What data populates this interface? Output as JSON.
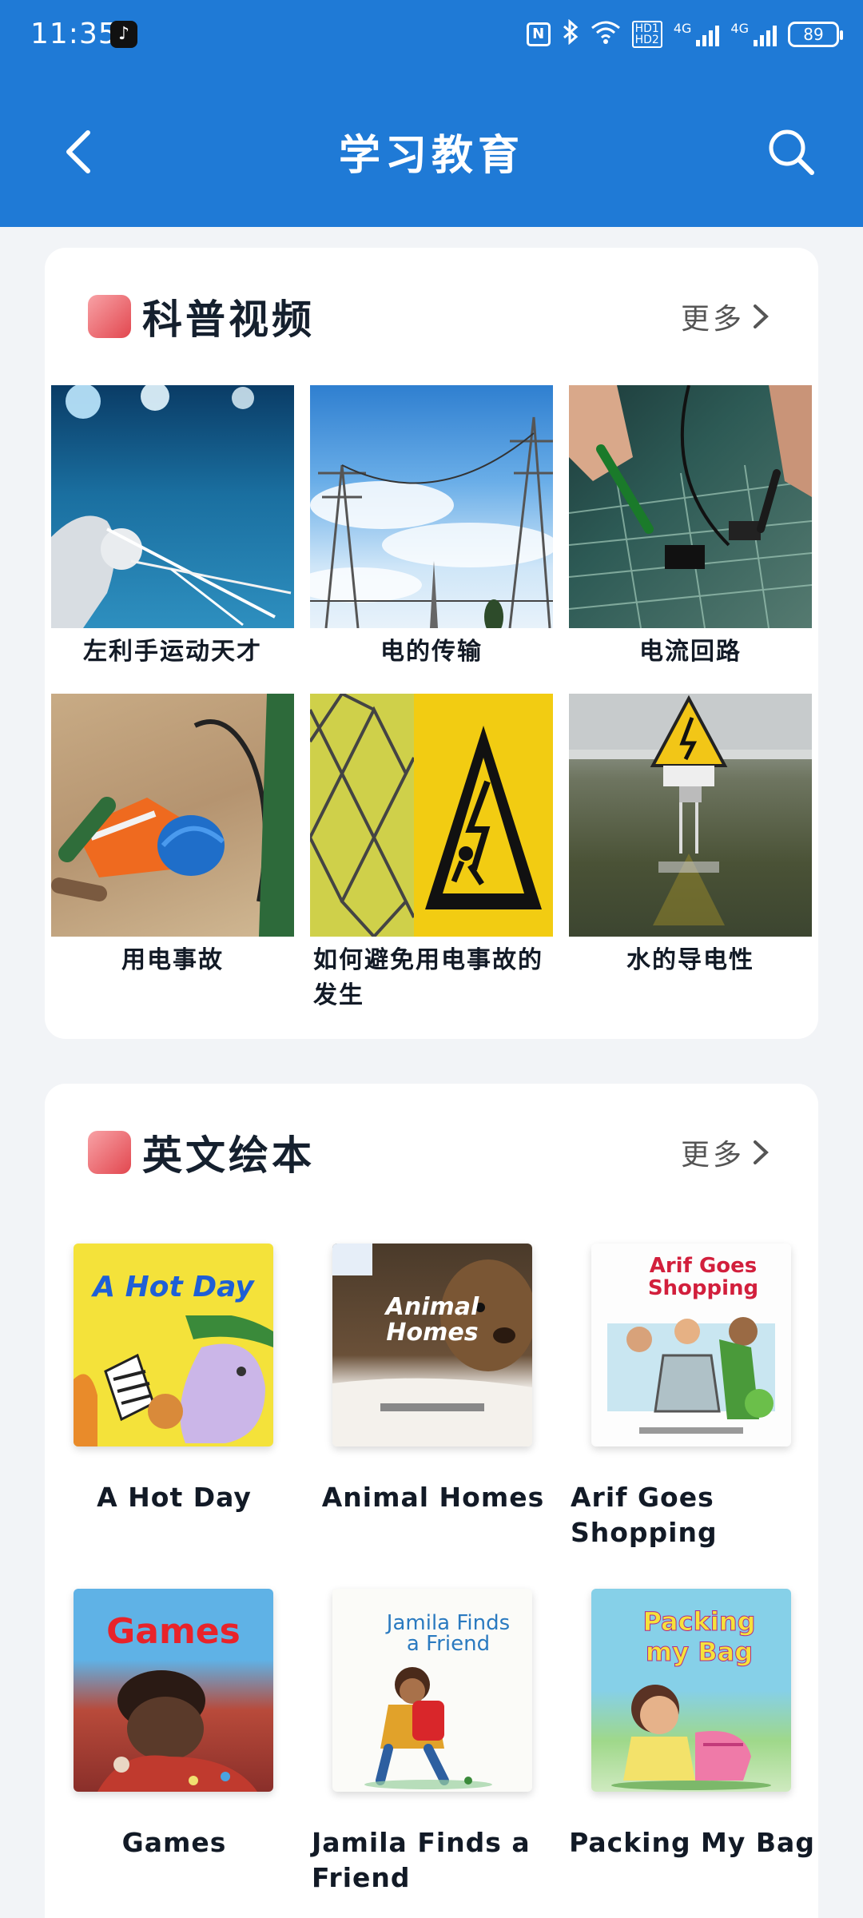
{
  "status_bar": {
    "time": "11:35",
    "hd_label": "HD1\nHD2",
    "net1": "4G",
    "net2": "4G",
    "battery": "89"
  },
  "header": {
    "title": "学习教育"
  },
  "science_section": {
    "title": "科普视频",
    "more_label": "更多",
    "videos": [
      {
        "caption": "左利手运动天才"
      },
      {
        "caption": "电的传输"
      },
      {
        "caption": "电流回路"
      },
      {
        "caption": "用电事故"
      },
      {
        "caption": "如何避免用电事故的发生"
      },
      {
        "caption": "水的导电性"
      }
    ]
  },
  "books_section": {
    "title": "英文绘本",
    "more_label": "更多",
    "books": [
      {
        "caption": "A Hot Day",
        "cover_title": "A Hot Day"
      },
      {
        "caption": "Animal Homes",
        "cover_title": "Animal Homes"
      },
      {
        "caption": "Arif Goes Shopping",
        "cover_title": "Arif Goes Shopping"
      },
      {
        "caption": "Games",
        "cover_title": "Games"
      },
      {
        "caption": "Jamila Finds a Friend",
        "cover_title": "Jamila Finds a Friend"
      },
      {
        "caption": "Packing My Bag",
        "cover_title": "Packing my Bag"
      }
    ]
  },
  "colors": {
    "header_blue": "#1f7ad6",
    "section_accent": "#e2474f"
  }
}
